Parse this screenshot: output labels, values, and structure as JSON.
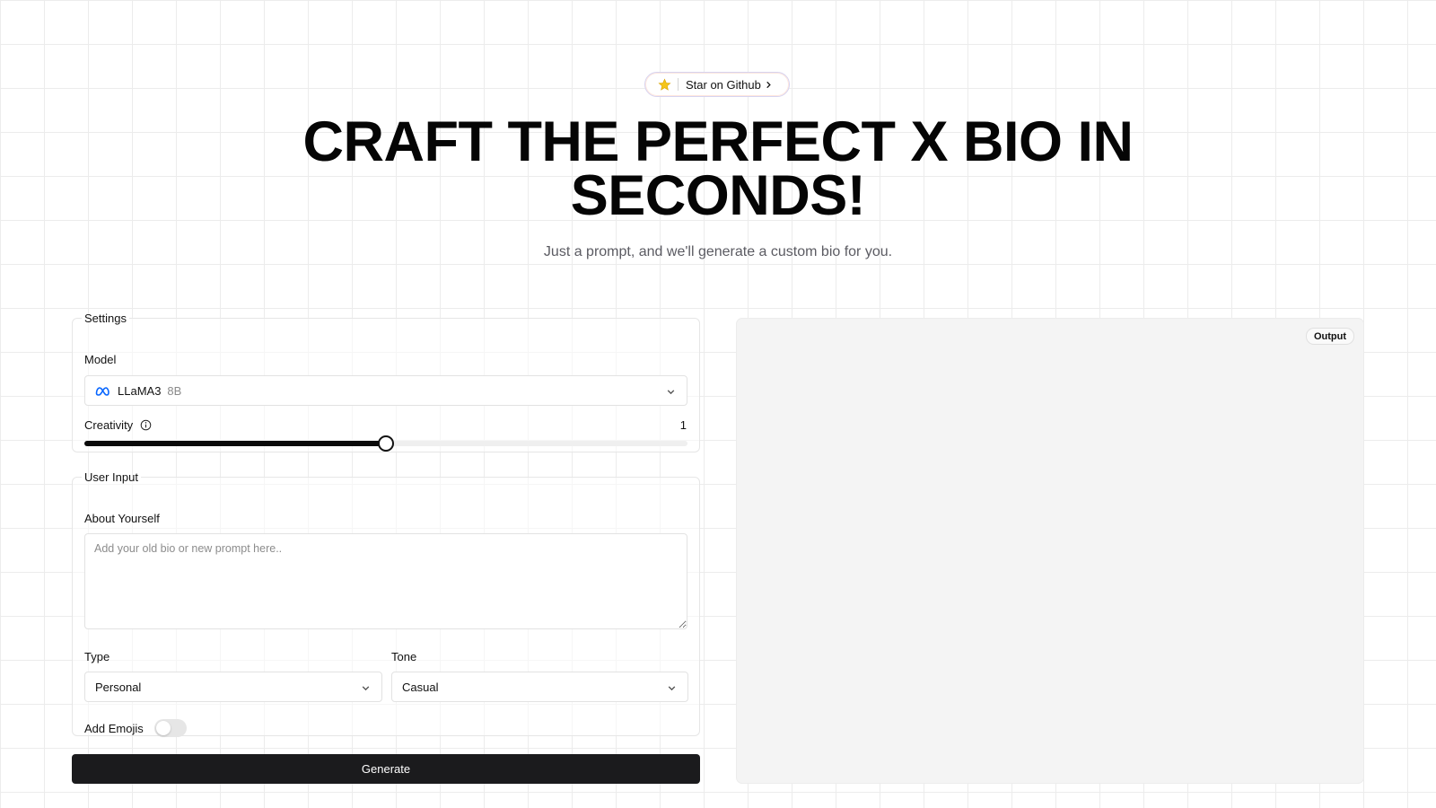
{
  "github": {
    "label": "Star on Github"
  },
  "hero": {
    "title_line1": "CRAFT THE PERFECT X BIO IN",
    "title_line2": "SECONDS!",
    "subtitle": "Just a prompt, and we'll generate a custom bio for you."
  },
  "settings": {
    "legend": "Settings",
    "model_label": "Model",
    "model_name": "LLaMA3",
    "model_size": "8B",
    "creativity_label": "Creativity",
    "creativity_value": "1",
    "creativity_fraction": 0.5
  },
  "user_input": {
    "legend": "User Input",
    "about_label": "About Yourself",
    "about_placeholder": "Add your old bio or new prompt here..",
    "about_value": "",
    "type_label": "Type",
    "type_value": "Personal",
    "tone_label": "Tone",
    "tone_value": "Casual",
    "emoji_label": "Add Emojis",
    "emoji_enabled": false
  },
  "actions": {
    "generate_label": "Generate"
  },
  "output": {
    "badge": "Output"
  },
  "colors": {
    "primary": "#1b1b1d",
    "meta_blue": "#0866ff",
    "star": "#f5c518"
  },
  "icons": {
    "github_star": "star-icon",
    "model_logo": "meta-logo-icon",
    "dropdown": "chevron-down-icon",
    "info": "info-icon"
  }
}
